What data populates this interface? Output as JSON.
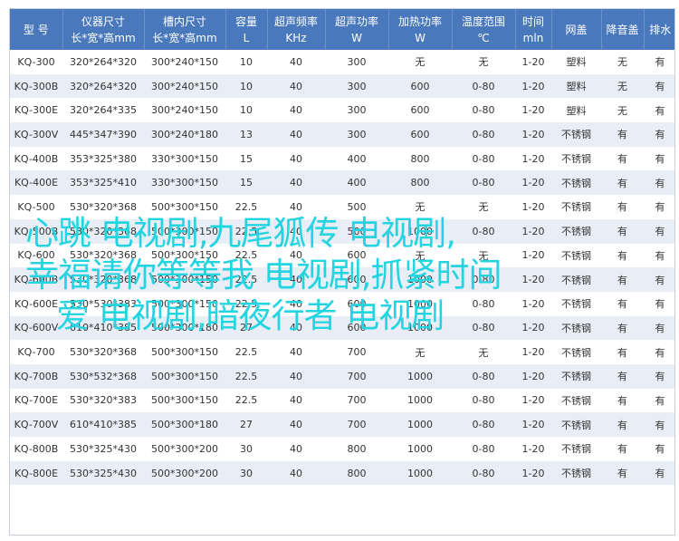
{
  "headers": [
    [
      "型 号",
      ""
    ],
    [
      "仪器尺寸",
      "长*宽*高mm"
    ],
    [
      "槽内尺寸",
      "长*宽*高mm"
    ],
    [
      "容量",
      "L"
    ],
    [
      "超声频率",
      "KHz"
    ],
    [
      "超声功率",
      "W"
    ],
    [
      "加热功率",
      "W"
    ],
    [
      "温度范围",
      "℃"
    ],
    [
      "时间",
      "mln"
    ],
    [
      "网盖",
      ""
    ],
    [
      "降音盖",
      ""
    ],
    [
      "排水",
      ""
    ]
  ],
  "rows": [
    [
      "KQ-300",
      "320*264*320",
      "300*240*150",
      "10",
      "40",
      "300",
      "无",
      "无",
      "1-20",
      "塑料",
      "无",
      "有"
    ],
    [
      "KQ-300B",
      "320*264*320",
      "300*240*150",
      "10",
      "40",
      "300",
      "600",
      "0-80",
      "1-20",
      "塑料",
      "无",
      "有"
    ],
    [
      "KQ-300E",
      "320*264*335",
      "300*240*150",
      "10",
      "40",
      "300",
      "600",
      "0-80",
      "1-20",
      "塑料",
      "无",
      "有"
    ],
    [
      "KQ-300V",
      "445*347*390",
      "300*240*180",
      "13",
      "40",
      "300",
      "600",
      "0-80",
      "1-20",
      "不锈钢",
      "有",
      "有"
    ],
    [
      "KQ-400B",
      "353*325*380",
      "330*300*150",
      "15",
      "40",
      "400",
      "800",
      "0-80",
      "1-20",
      "不锈钢",
      "有",
      "有"
    ],
    [
      "KQ-400E",
      "353*325*410",
      "330*300*150",
      "15",
      "40",
      "400",
      "800",
      "0-80",
      "1-20",
      "不锈钢",
      "有",
      "有"
    ],
    [
      "KQ-500",
      "530*320*368",
      "500*300*150",
      "22.5",
      "40",
      "500",
      "无",
      "无",
      "1-20",
      "不锈钢",
      "有",
      "有"
    ],
    [
      "KQ-500B",
      "530*320*368",
      "500*300*150",
      "22.5",
      "40",
      "500",
      "1000",
      "0-80",
      "1-20",
      "不锈钢",
      "有",
      "有"
    ],
    [
      "KQ-600",
      "530*320*368",
      "500*300*150",
      "22.5",
      "40",
      "600",
      "无",
      "无",
      "1-20",
      "不锈钢",
      "有",
      "有"
    ],
    [
      "KQ-600B",
      "530*320*368",
      "500*300*150",
      "22.5",
      "40",
      "600",
      "1000",
      "0-80",
      "1-20",
      "不锈钢",
      "有",
      "有"
    ],
    [
      "KQ-600E",
      "530*530*383",
      "500*300*150",
      "22.5",
      "40",
      "600",
      "1000",
      "0-80",
      "1-20",
      "不锈钢",
      "有",
      "有"
    ],
    [
      "KQ-600V",
      "610*410*385",
      "500*300*180",
      "27",
      "40",
      "600",
      "1000",
      "0-80",
      "1-20",
      "不锈钢",
      "有",
      "有"
    ],
    [
      "KQ-700",
      "530*320*368",
      "500*300*150",
      "22.5",
      "40",
      "700",
      "无",
      "无",
      "1-20",
      "不锈钢",
      "有",
      "有"
    ],
    [
      "KQ-700B",
      "530*532*368",
      "500*300*150",
      "22.5",
      "40",
      "700",
      "1000",
      "0-80",
      "1-20",
      "不锈钢",
      "有",
      "有"
    ],
    [
      "KQ-700E",
      "530*320*383",
      "500*300*150",
      "22.5",
      "40",
      "700",
      "1000",
      "0-80",
      "1-20",
      "不锈钢",
      "有",
      "有"
    ],
    [
      "KQ-700V",
      "610*410*385",
      "500*300*180",
      "27",
      "40",
      "700",
      "1000",
      "0-80",
      "1-20",
      "不锈钢",
      "有",
      "有"
    ],
    [
      "KQ-800B",
      "530*325*430",
      "500*300*200",
      "30",
      "40",
      "800",
      "1000",
      "0-80",
      "1-20",
      "不锈钢",
      "有",
      "有"
    ],
    [
      "KQ-800E",
      "530*325*430",
      "500*300*200",
      "30",
      "40",
      "800",
      "1000",
      "0-80",
      "1-20",
      "不锈钢",
      "有",
      "有"
    ]
  ],
  "overlay_text": [
    "心跳 电视剧,九尾狐传 电视剧,",
    "幸福请你等等我 电视剧,抓紧时间",
    "爱 电视剧,暗夜行者 电视剧"
  ],
  "colors": {
    "header_bg": "#4a78bc",
    "stripe": "#e9eef6",
    "overlay": "#24d4e0"
  }
}
